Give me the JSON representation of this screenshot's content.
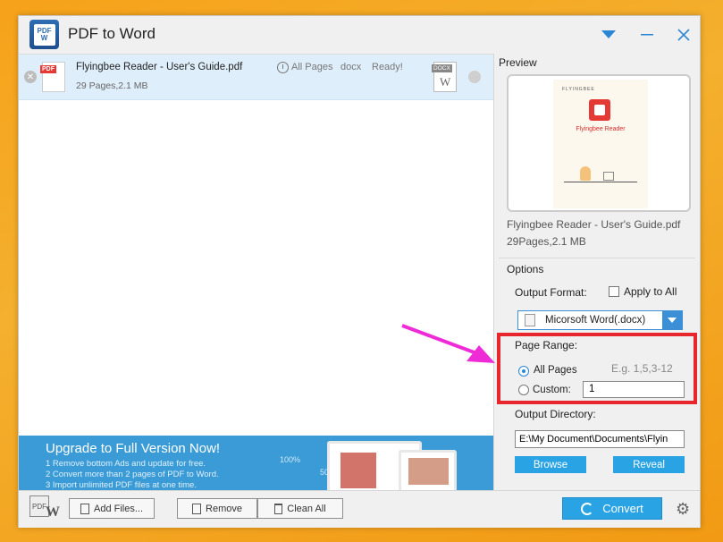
{
  "window": {
    "title": "PDF to Word"
  },
  "file_list": [
    {
      "name": "Flyingbee Reader - User's Guide.pdf",
      "meta": "29 Pages,2.1 MB",
      "pages": "All Pages",
      "format": "docx",
      "status": "Ready!"
    }
  ],
  "ad": {
    "title": "Upgrade to Full Version Now!",
    "lines": [
      "1 Remove bottom Ads and update for free.",
      "2 Convert more than 2 pages of PDF to Word.",
      "3 Import unlimited PDF files at one time."
    ],
    "pct": "100%",
    "num": "50"
  },
  "preview": {
    "label": "Preview",
    "brand": "FLYINGBEE",
    "doc_title": "Flyingbee Reader",
    "file_name": "Flyingbee Reader - User's Guide.pdf",
    "file_meta": "29Pages,2.1 MB"
  },
  "options": {
    "label": "Options",
    "output_format_label": "Output Format:",
    "apply_all_label": "Apply to All",
    "format_value": "Micorsoft Word(.docx)",
    "page_range_label": "Page Range:",
    "example": "E.g. 1,5,3-12",
    "all_pages_label": "All Pages",
    "custom_label": "Custom:",
    "custom_value": "1",
    "output_dir_label": "Output Directory:",
    "output_dir_value": "E:\\My Document\\Documents\\Flyin",
    "browse_label": "Browse",
    "reveal_label": "Reveal"
  },
  "toolbar": {
    "add_files": "Add Files...",
    "remove": "Remove",
    "clean_all": "Clean All",
    "convert": "Convert"
  },
  "colors": {
    "accent": "#29a3e3",
    "highlight": "#e8262e",
    "arrow": "#ee2bd6"
  }
}
